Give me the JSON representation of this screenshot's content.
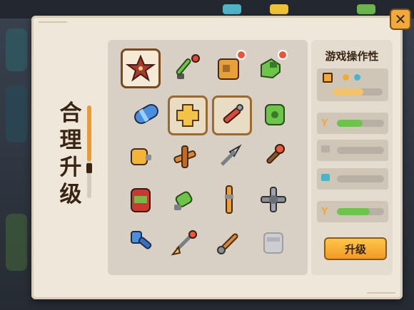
{
  "panel": {
    "title_chars": [
      "合",
      "理",
      "升",
      "级"
    ]
  },
  "side_panel": {
    "title": "游戏操作性",
    "upgrade_label": "升级",
    "slider_levels": [
      0.62,
      0.55,
      0.0,
      0.0,
      0.7
    ]
  },
  "close_icon": "close-icon",
  "grid": {
    "items": [
      {
        "name": "star-emblem",
        "selected": true
      },
      {
        "name": "green-wrench"
      },
      {
        "name": "orange-cube",
        "badge": true
      },
      {
        "name": "green-boot",
        "badge": true
      },
      {
        "name": "blue-capsule"
      },
      {
        "name": "yellow-plus-block",
        "highlight": true
      },
      {
        "name": "red-dart",
        "highlight": true
      },
      {
        "name": "green-shield"
      },
      {
        "name": "yellow-canister"
      },
      {
        "name": "cross-joint"
      },
      {
        "name": "silver-spear"
      },
      {
        "name": "torch-stick"
      },
      {
        "name": "red-barrel"
      },
      {
        "name": "green-pin"
      },
      {
        "name": "orange-rod"
      },
      {
        "name": "steel-connector"
      },
      {
        "name": "blue-mallet"
      },
      {
        "name": "spike-rod"
      },
      {
        "name": "copper-rod"
      },
      {
        "name": "stone-gauntlet"
      }
    ]
  },
  "colors": {
    "accent": "#f2a93b",
    "panel": "#efe7d9",
    "progress_green": "#6cc44a"
  }
}
